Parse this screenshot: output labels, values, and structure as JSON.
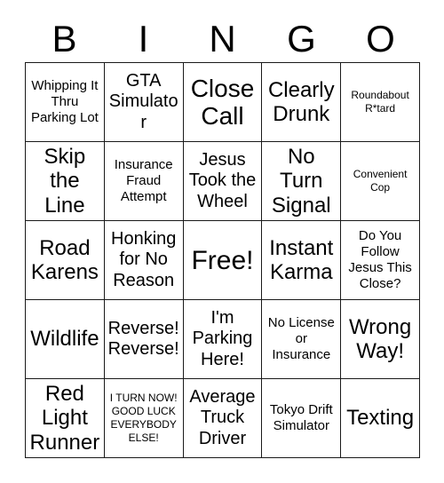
{
  "card": {
    "title": "BINGO",
    "header_letters": [
      "B",
      "I",
      "N",
      "G",
      "O"
    ],
    "columns": 5,
    "rows": 5,
    "border_color": "#1a1a1a",
    "background_color": "#ffffff",
    "text_color": "#000000",
    "cells": [
      {
        "text": "Whipping It Thru Parking Lot",
        "size": "sm",
        "row": 1,
        "col": 1,
        "free": false
      },
      {
        "text": "GTA Simulator",
        "size": "md",
        "row": 1,
        "col": 2,
        "free": false
      },
      {
        "text": "Close Call",
        "size": "xl",
        "row": 1,
        "col": 3,
        "free": false
      },
      {
        "text": "Clearly Drunk",
        "size": "lg",
        "row": 1,
        "col": 4,
        "free": false
      },
      {
        "text": "Roundabout R*tard",
        "size": "xs",
        "row": 1,
        "col": 5,
        "free": false
      },
      {
        "text": "Skip the Line",
        "size": "lg",
        "row": 2,
        "col": 1,
        "free": false
      },
      {
        "text": "Insurance Fraud Attempt",
        "size": "sm",
        "row": 2,
        "col": 2,
        "free": false
      },
      {
        "text": "Jesus Took the Wheel",
        "size": "md",
        "row": 2,
        "col": 3,
        "free": false
      },
      {
        "text": "No Turn Signal",
        "size": "lg",
        "row": 2,
        "col": 4,
        "free": false
      },
      {
        "text": "Convenient Cop",
        "size": "xs",
        "row": 2,
        "col": 5,
        "free": false
      },
      {
        "text": "Road Karens",
        "size": "lg",
        "row": 3,
        "col": 1,
        "free": false
      },
      {
        "text": "Honking for No Reason",
        "size": "md",
        "row": 3,
        "col": 2,
        "free": false
      },
      {
        "text": "Free!",
        "size": "free",
        "row": 3,
        "col": 3,
        "free": true
      },
      {
        "text": "Instant Karma",
        "size": "lg",
        "row": 3,
        "col": 4,
        "free": false
      },
      {
        "text": "Do You Follow Jesus This Close?",
        "size": "sm",
        "row": 3,
        "col": 5,
        "free": false
      },
      {
        "text": "Wildlife",
        "size": "lg",
        "row": 4,
        "col": 1,
        "free": false
      },
      {
        "text": "Reverse! Reverse!",
        "size": "md",
        "row": 4,
        "col": 2,
        "free": false
      },
      {
        "text": "I'm Parking Here!",
        "size": "md",
        "row": 4,
        "col": 3,
        "free": false
      },
      {
        "text": "No License or Insurance",
        "size": "sm",
        "row": 4,
        "col": 4,
        "free": false
      },
      {
        "text": "Wrong Way!",
        "size": "lg",
        "row": 4,
        "col": 5,
        "free": false
      },
      {
        "text": "Red Light Runner",
        "size": "lg",
        "row": 5,
        "col": 1,
        "free": false
      },
      {
        "text": "I TURN NOW! GOOD LUCK EVERYBODY ELSE!",
        "size": "xs",
        "row": 5,
        "col": 2,
        "free": false
      },
      {
        "text": "Average Truck Driver",
        "size": "md",
        "row": 5,
        "col": 3,
        "free": false
      },
      {
        "text": "Tokyo Drift Simulator",
        "size": "sm",
        "row": 5,
        "col": 4,
        "free": false
      },
      {
        "text": "Texting",
        "size": "lg",
        "row": 5,
        "col": 5,
        "free": false
      }
    ]
  }
}
